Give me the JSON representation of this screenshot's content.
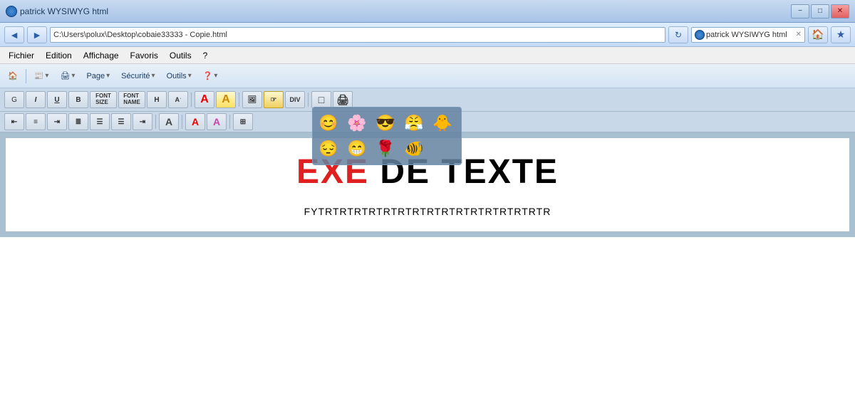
{
  "titlebar": {
    "title": "patrick WYSIWYG html",
    "minimize_label": "−",
    "restore_label": "□",
    "close_label": "✕"
  },
  "addressbar": {
    "back_label": "◄",
    "forward_label": "►",
    "address_value": "C:\\Users\\polux\\Desktop\\cobaie33333 - Copie.html",
    "search_placeholder": "patrick WYSIWYG html",
    "tab_label": "patrick WYSIWYG html",
    "refresh_label": "↻",
    "home_label": "🏠"
  },
  "menubar": {
    "items": [
      "Fichier",
      "Edition",
      "Affichage",
      "Favoris",
      "Outils",
      "?"
    ]
  },
  "ie_toolbar": {
    "buttons": [
      {
        "label": "🏠",
        "name": "home-btn"
      },
      {
        "label": "📰",
        "name": "feeds-btn",
        "dropdown": true
      },
      {
        "label": "🖨",
        "name": "print-btn",
        "dropdown": true
      },
      {
        "label": "Page ▾",
        "name": "page-btn"
      },
      {
        "label": "Sécurité ▾",
        "name": "security-btn"
      },
      {
        "label": "Outils ▾",
        "name": "tools-btn"
      },
      {
        "label": "❓ ▾",
        "name": "help-btn"
      }
    ]
  },
  "editor_toolbar_row1": {
    "buttons": [
      {
        "label": "G",
        "name": "bold-g-btn"
      },
      {
        "label": "I",
        "name": "italic-btn",
        "italic": true
      },
      {
        "label": "U",
        "name": "underline-btn"
      },
      {
        "label": "B",
        "name": "bold-btn"
      },
      {
        "label": "FONT SIZE",
        "name": "font-size-btn",
        "wide": true
      },
      {
        "label": "FONT NAME",
        "name": "font-name-btn",
        "wide": true
      },
      {
        "label": "H",
        "name": "h-btn"
      },
      {
        "label": "A'",
        "name": "a-prime-btn"
      },
      {
        "label": "A",
        "name": "color-a-btn",
        "color": "#e00"
      },
      {
        "label": "A",
        "name": "color-a2-btn",
        "bg": "#ffd700"
      },
      {
        "label": "🖼",
        "name": "image-btn"
      },
      {
        "label": "☞",
        "name": "cursor-btn",
        "active": true
      },
      {
        "label": "DIV",
        "name": "div-btn"
      },
      {
        "label": "□",
        "name": "new-btn"
      },
      {
        "label": "🖨",
        "name": "print2-btn"
      }
    ]
  },
  "editor_toolbar_row2": {
    "buttons": [
      {
        "label": "≡",
        "name": "align-left-btn"
      },
      {
        "label": "≡",
        "name": "align-center-btn"
      },
      {
        "label": "≡",
        "name": "align-right-btn"
      },
      {
        "label": "≡",
        "name": "justify-btn"
      },
      {
        "label": "≡",
        "name": "list-btn"
      },
      {
        "label": "≡",
        "name": "list2-btn"
      },
      {
        "label": "≡",
        "name": "indent-btn"
      },
      {
        "label": "A",
        "name": "format-a-btn"
      },
      {
        "label": "A",
        "name": "color-picker-a-btn",
        "color": "#e00"
      },
      {
        "label": "A",
        "name": "highlight-a-btn",
        "bg": "pink"
      },
      {
        "label": "⊞",
        "name": "table-btn"
      }
    ]
  },
  "emoji_popup": {
    "items": [
      {
        "emoji": "😊",
        "name": "smile-emoji"
      },
      {
        "emoji": "🌸",
        "name": "flower-emoji"
      },
      {
        "emoji": "😎",
        "name": "cool-emoji"
      },
      {
        "emoji": "😤",
        "name": "angry-emoji"
      },
      {
        "emoji": "🐥",
        "name": "chick-emoji"
      },
      {
        "emoji": "😔",
        "name": "sad-emoji"
      },
      {
        "emoji": "😁",
        "name": "grin-emoji"
      },
      {
        "emoji": "🌹",
        "name": "rose-emoji"
      },
      {
        "emoji": "🐠",
        "name": "fish-emoji"
      }
    ]
  },
  "content": {
    "title_red": "EXE",
    "title_black": "DE TEXTE",
    "body_text": "FYTRTRTRTRTRTRTRTRTRTRTRTRTRTRTRTR"
  }
}
